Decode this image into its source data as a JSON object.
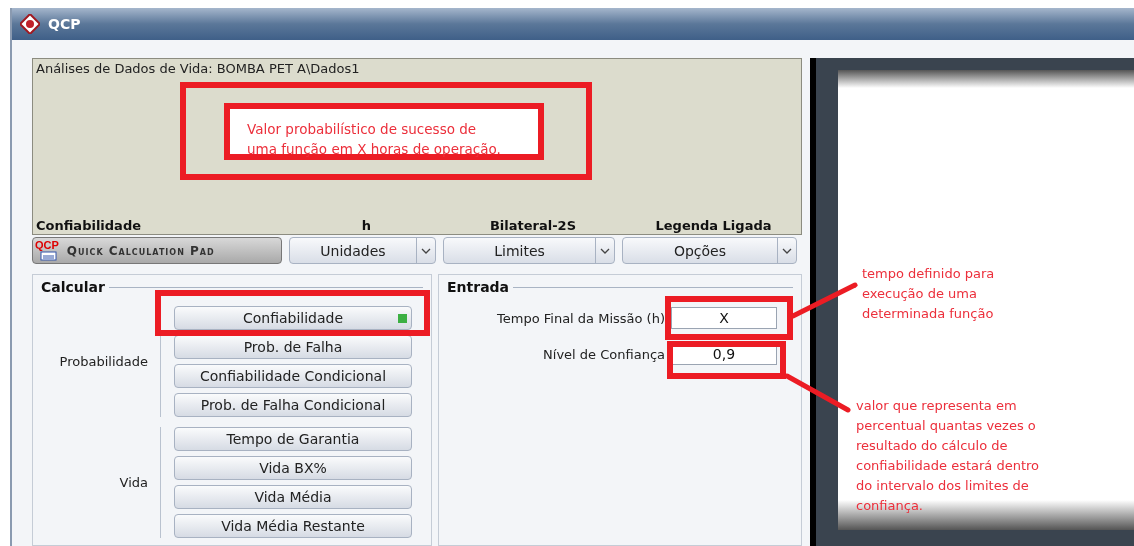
{
  "window": {
    "title": "QCP"
  },
  "info": {
    "title": "Análises de Dados de Vida: BOMBA PET A\\Dados1"
  },
  "header_labels": [
    "Confiabilidade",
    "h",
    "Bilateral-2S",
    "Legenda Ligada"
  ],
  "toolbar": {
    "pad_button": {
      "logo_text": "QCP",
      "label": "Quick Calculation Pad"
    },
    "dropdowns": [
      "Unidades",
      "Limites",
      "Opções"
    ]
  },
  "calcular": {
    "title": "Calcular",
    "groups": [
      {
        "label": "Probabilidade",
        "buttons": [
          {
            "label": "Confiabilidade",
            "selected": true
          },
          {
            "label": "Prob. de Falha",
            "selected": false
          },
          {
            "label": "Confiabilidade Condicional",
            "selected": false
          },
          {
            "label": "Prob. de Falha Condicional",
            "selected": false
          }
        ]
      },
      {
        "label": "Vida",
        "buttons": [
          {
            "label": "Tempo de Garantia",
            "selected": false
          },
          {
            "label": "Vida BX%",
            "selected": false
          },
          {
            "label": "Vida Média",
            "selected": false
          },
          {
            "label": "Vida Média Restante",
            "selected": false
          }
        ]
      }
    ]
  },
  "entrada": {
    "title": "Entrada",
    "fields": [
      {
        "label": "Tempo Final da Missão (h)",
        "value": "X"
      },
      {
        "label": "Nível de Confiança",
        "value": "0,9"
      }
    ]
  },
  "annotations": [
    {
      "kind": "callout",
      "text": "Valor probabilístico de sucesso de uma função em X horas de operação."
    },
    {
      "kind": "note",
      "text": "tempo definido para execução de uma determinada função"
    },
    {
      "kind": "note",
      "text": "valor que representa em percentual quantas vezes o resultado do cálculo de confiabilidade estará dentro do intervalo dos limites de confiança."
    }
  ]
}
